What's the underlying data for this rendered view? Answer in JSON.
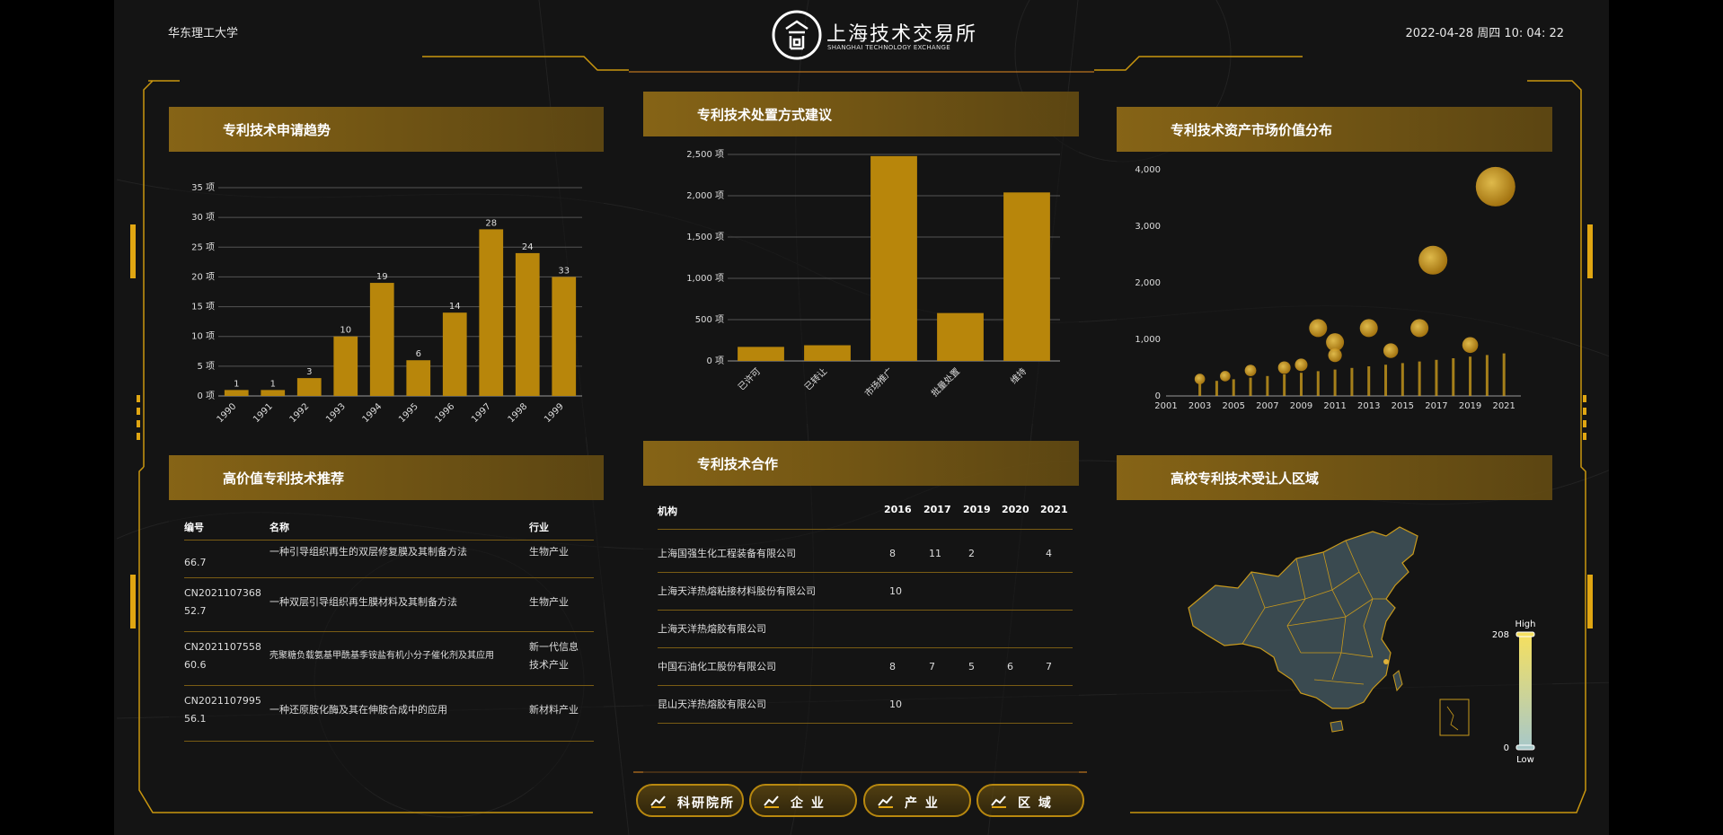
{
  "header": {
    "university": "华东理工大学",
    "logo_title": "上海技术交易所",
    "logo_subtitle": "SHANGHAI TECHNOLOGY EXCHANGE",
    "datetime": "2022-04-28 周四 10: 04: 22"
  },
  "panels": {
    "trend": {
      "title": "专利技术申请趋势"
    },
    "disposal": {
      "title": "专利技术处置方式建议"
    },
    "value": {
      "title": "专利技术资产市场价值分布"
    },
    "recommend": {
      "title": "高价值专利技术推荐"
    },
    "cooperation": {
      "title": "专利技术合作"
    },
    "region": {
      "title": "高校专利技术受让人区域"
    }
  },
  "colors": {
    "gold": "#b8860b",
    "gold_light": "#e0b23a",
    "panel_head": "#8c6816",
    "map_fill": "#3a4a50",
    "map_stroke": "#c99a1c"
  },
  "chart_data": [
    {
      "type": "bar",
      "title": "专利技术申请趋势",
      "categories": [
        "1990",
        "1991",
        "1992",
        "1993",
        "1994",
        "1995",
        "1996",
        "1997",
        "1998",
        "1999"
      ],
      "values": [
        1,
        1,
        3,
        10,
        19,
        6,
        14,
        28,
        24,
        20
      ],
      "data_labels": [
        "1",
        "1",
        "3",
        "10",
        "19",
        "6",
        "14",
        "28",
        "24",
        "33"
      ],
      "ylim": [
        0,
        35
      ],
      "yticks": [
        "0 项",
        "5 项",
        "10 项",
        "15 项",
        "20 项",
        "25 项",
        "30 项",
        "35 项"
      ],
      "grid": true
    },
    {
      "type": "bar",
      "title": "专利技术处置方式建议",
      "categories": [
        "已许可",
        "已转让",
        "市场推广",
        "批量处置",
        "维持"
      ],
      "values": [
        170,
        190,
        2480,
        580,
        2040
      ],
      "ylim": [
        0,
        2500
      ],
      "yticks": [
        "0 项",
        "500 项",
        "1,000 项",
        "1,500 项",
        "2,000 项",
        "2,500 项"
      ],
      "grid": true
    },
    {
      "type": "scatter",
      "title": "专利技术资产市场价值分布",
      "xticks": [
        "2001",
        "2003",
        "2005",
        "2007",
        "2009",
        "2011",
        "2013",
        "2015",
        "2017",
        "2019",
        "2021"
      ],
      "yticks": [
        "0",
        "1,000",
        "2,000",
        "3,000",
        "4,000"
      ],
      "xlim": [
        2001,
        2022
      ],
      "ylim": [
        0,
        4000
      ],
      "bubbles": [
        {
          "x": 2020.5,
          "y": 3700,
          "r": 3
        },
        {
          "x": 2016.8,
          "y": 2400,
          "r": 2
        },
        {
          "x": 2010,
          "y": 1200,
          "r": 1
        },
        {
          "x": 2011,
          "y": 950,
          "r": 1
        },
        {
          "x": 2011,
          "y": 720,
          "r": 0.6
        },
        {
          "x": 2013,
          "y": 1200,
          "r": 1
        },
        {
          "x": 2014.3,
          "y": 800,
          "r": 0.7
        },
        {
          "x": 2016,
          "y": 1200,
          "r": 1
        },
        {
          "x": 2019,
          "y": 900,
          "r": 0.8
        },
        {
          "x": 2009,
          "y": 550,
          "r": 0.5
        },
        {
          "x": 2008,
          "y": 500,
          "r": 0.5
        },
        {
          "x": 2004.5,
          "y": 350,
          "r": 0.3
        },
        {
          "x": 2003,
          "y": 300,
          "r": 0.3
        },
        {
          "x": 2006,
          "y": 450,
          "r": 0.4
        }
      ]
    },
    {
      "type": "heatmap",
      "title": "高校专利技术受让人区域",
      "legend": {
        "high_label": "High",
        "low_label": "Low",
        "max": "208",
        "min": "0"
      }
    }
  ],
  "recommend_table": {
    "headers": [
      "编号",
      "名称",
      "行业"
    ],
    "rows": [
      {
        "id": "66.7",
        "name": "一种引导组织再生的双层修复膜及其制备方法",
        "industry": "生物产业"
      },
      {
        "id": "CN2021107368 52.7",
        "name": "一种双层引导组织再生膜材料及其制备方法",
        "industry": "生物产业"
      },
      {
        "id": "CN2021107558 60.6",
        "name": "壳聚糖负载氨基甲酰基季铵盐有机小分子催化剂及其应用",
        "industry": "新一代信息 技术产业"
      },
      {
        "id": "CN2021107995 56.1",
        "name": "一种还原胺化酶及其在伸胺合成中的应用",
        "industry": "新材料产业"
      }
    ]
  },
  "cooperation_table": {
    "headers": [
      "机构",
      "2016",
      "2017",
      "2019",
      "2020",
      "2021"
    ],
    "rows": [
      {
        "org": "上海国强生化工程装备有限公司",
        "v": [
          "8",
          "11",
          "2",
          "",
          "4"
        ]
      },
      {
        "org": "上海天洋热熔粘接材料股份有限公司",
        "v": [
          "10",
          "",
          "",
          "",
          ""
        ]
      },
      {
        "org": "上海天洋热熔胶有限公司",
        "v": [
          "",
          "",
          "",
          "",
          ""
        ]
      },
      {
        "org": "中国石油化工股份有限公司",
        "v": [
          "8",
          "7",
          "5",
          "6",
          "7"
        ]
      },
      {
        "org": "昆山天洋热熔胶有限公司",
        "v": [
          "10",
          "",
          "",
          "",
          ""
        ]
      }
    ]
  },
  "nav": [
    {
      "label": "科研院所",
      "icon": "trend-icon"
    },
    {
      "label": "企 业",
      "icon": "trend-icon"
    },
    {
      "label": "产 业",
      "icon": "trend-icon"
    },
    {
      "label": "区 域",
      "icon": "trend-icon"
    }
  ]
}
